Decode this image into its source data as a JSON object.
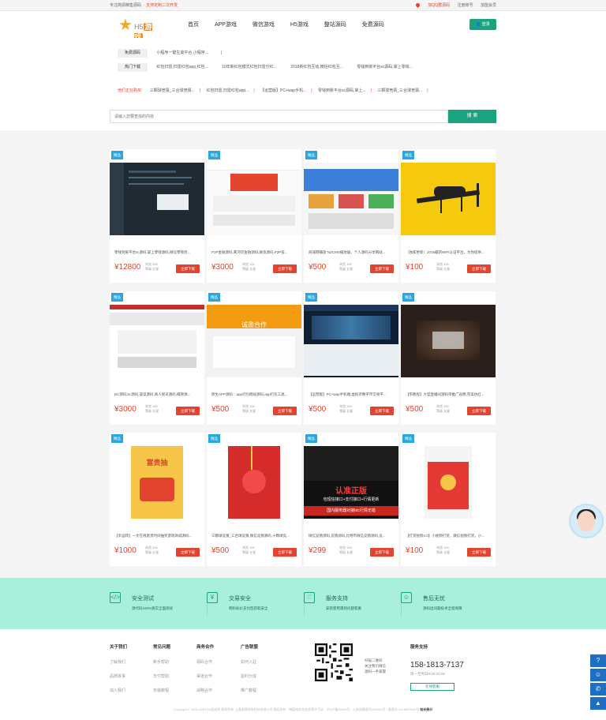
{
  "topbar": {
    "slogan": "专注简源精售源码",
    "slogan2": "· 支持定制二次开发",
    "qq_group": "加QQ群源码",
    "register": "注册账号",
    "vip": "加盟会员"
  },
  "header": {
    "logo_text": "H5",
    "logo_badge": "游戏",
    "nav": [
      "首页",
      "APP游戏",
      "微信游戏",
      "H5游戏",
      "整站源码",
      "免费源码"
    ],
    "login": "登录"
  },
  "hot": {
    "free_label": "免费源码",
    "free_items": [
      "小程序一键生成平台,小程序...",
      "|"
    ],
    "download_label": "热门下载",
    "download_items": [
      "红包扫雷,扫雷红包app,红包...",
      "10年新红包模式红包扫雷分红...",
      "2018新红包互动,微信红包互...",
      "零钱到账平台sc源码,掌上零钱..."
    ],
    "buying_label": "他们正在购买:",
    "buying_items": [
      "三颗球竞猜_三合球竞猜...",
      "红包扫雷,扫雷红包app...",
      "【运营版】PC+wap手机...",
      "零钱到账平台sc源码,掌上...",
      "三颗球竞猜_三合球竞猜..."
    ]
  },
  "search": {
    "placeholder": "请输入您要查找的内容",
    "button": "搜 索"
  },
  "cards": [
    {
      "badge": "精品",
      "title": "零钱到账平台sc源码,掌上零钱源码,微信零钱到...",
      "price": "¥12800",
      "views": "浏览 100",
      "level": "等级 五星",
      "dl": "立即下载"
    },
    {
      "badge": "精品",
      "title": "P2P金融源码,黄河贷金融源码,融资源码,P2P投...",
      "price": "¥3000",
      "views": "浏览 100",
      "level": "等级 五星",
      "dl": "立即下载"
    },
    {
      "badge": "精品",
      "title": "商城网播放 NZCMS播放器，个人源码分享网站...",
      "price": "¥500",
      "views": "浏览 100",
      "level": "等级 五星",
      "dl": "立即下载"
    },
    {
      "badge": "精品",
      "title": "（独家更新）2018最新WIFI认证平台，为你提供...",
      "price": "¥100",
      "views": "浏览 100",
      "level": "等级 五星",
      "dl": "立即下载"
    },
    {
      "badge": "精品",
      "title": "BC源码,bc源码,菠菜源码,真人视讯源码,棋牌源...",
      "price": "¥3000",
      "views": "浏览 100",
      "level": "等级 五星",
      "dl": "立即下载"
    },
    {
      "badge": "精品",
      "title": "原生APP源码：app打包网站源码,app打包工具...",
      "price": "¥500",
      "views": "浏览 100",
      "level": "等级 五星",
      "dl": "立即下载"
    },
    {
      "badge": "精品",
      "title": "【运营版】PC+wap手机端,虚拟币数字币交易平...",
      "price": "¥500",
      "views": "浏览 100",
      "level": "等级 五星",
      "dl": "立即下载"
    },
    {
      "badge": "精品",
      "title": "【带教程】大型直播间源码带推广返佣,完美仿红...",
      "price": "¥500",
      "views": "浏览 100",
      "level": "等级 五星",
      "dl": "立即下载"
    },
    {
      "badge": "精品",
      "title": "【幸运转】一文在线富贵时间抽奖游戏商城源码...",
      "price": "¥1000",
      "views": "浏览 100",
      "level": "等级 五星",
      "dl": "立即下载"
    },
    {
      "badge": "精品",
      "title": "三颗球竞猜_三合球竞猜,微信竞猜源码,十颗球竞...",
      "price": "¥500",
      "views": "浏览 100",
      "level": "等级 五星",
      "dl": "立即下载"
    },
    {
      "badge": "精品",
      "title": "微信竞猜源码,竞猜源码,比特币微信竞猜源码,竞...",
      "price": "¥299",
      "views": "浏览 100",
      "level": "等级 五星",
      "dl": "立即下载"
    },
    {
      "badge": "精品",
      "title": "【打赏视频4.0】小视频打赏，微信视频打赏，小...",
      "price": "¥100",
      "views": "浏览 100",
      "level": "等级 五星",
      "dl": "立即下载"
    }
  ],
  "card_art": {
    "c11_line1": "认准正版",
    "c11_line2": "包短信接口+支付接口+行情更新",
    "c11_line3": "国内服务器对接btc行情无错",
    "c6_title": "诚邀合作",
    "c9_title": "富贵抽"
  },
  "features": [
    {
      "title": "安全测试",
      "desc": "源代码100%真实全面测试"
    },
    {
      "title": "交易安全",
      "desc": "明码标价支付后获取安全"
    },
    {
      "title": "服务支持",
      "desc": "安装使用遇到问题客服"
    },
    {
      "title": "售后无忧",
      "desc": "源码出问题技术全程保障"
    }
  ],
  "footer": {
    "cols": [
      {
        "h": "关于我们",
        "items": [
          "了解我们",
          "品牌故事",
          "加入我们"
        ]
      },
      {
        "h": "常见问题",
        "items": [
          "新手帮助",
          "支付帮助",
          "安装教程"
        ]
      },
      {
        "h": "商务合作",
        "items": [
          "源码合作",
          "渠道合作",
          "战略合作"
        ]
      },
      {
        "h": "广告联盟",
        "items": [
          "如何入驻",
          "盈利分成",
          "推广教程"
        ]
      }
    ],
    "qr_text": [
      "扫描二维码",
      "关注我们微信",
      "源码一手掌握"
    ],
    "service": {
      "h": "服务支持",
      "tel": "158-1813-7137",
      "hours": "周一至周日9:00-22:00",
      "online": "在线客服"
    },
    "copyright": "Copyright © 2005-2018 H5游戏网 版权所有 上海游骋网络科技有限公司 版权所有 · 增值电信业务经营许可证 · 沪ICP备00000号 · 公安部备案号000000号 · 备案号 2018000000号",
    "stats": "站长统计"
  },
  "colors": {
    "accent": "#1aa37f",
    "red": "#e2442f",
    "badge": "#29a8e0",
    "feature_bg": "#a8efdc"
  }
}
